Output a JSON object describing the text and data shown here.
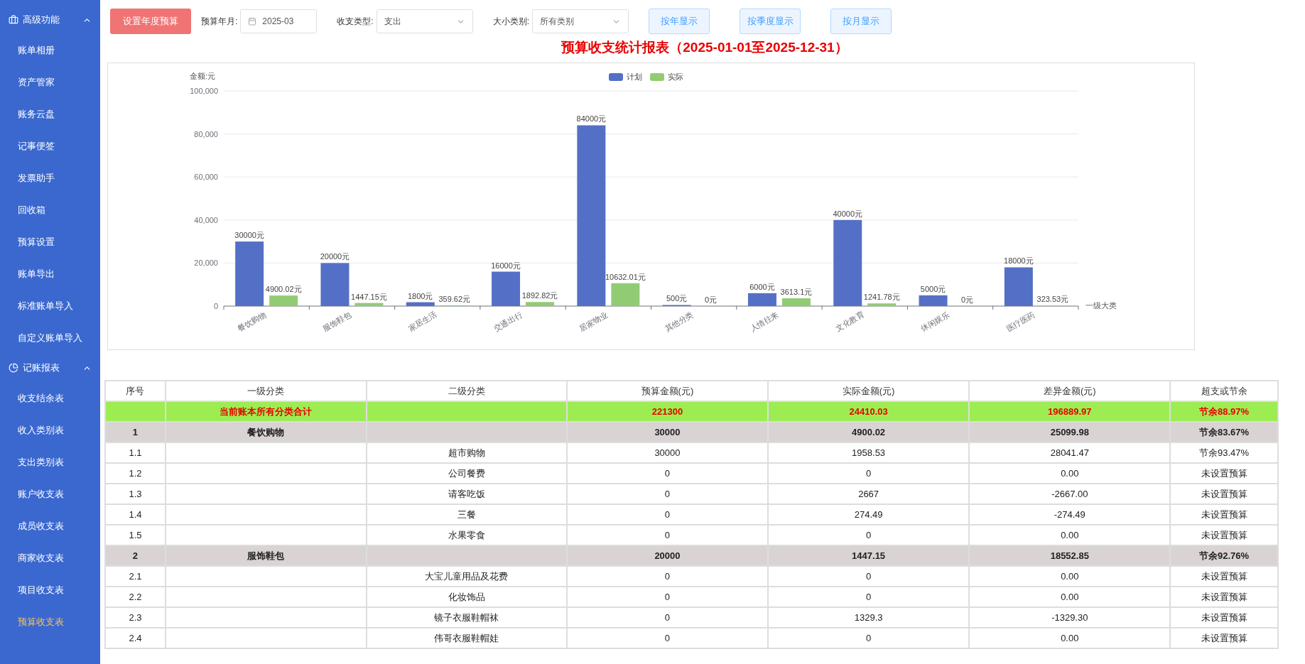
{
  "sidebar": {
    "sections": [
      {
        "title": "高级功能",
        "expanded": true,
        "items": [
          {
            "label": "账单相册",
            "selected": false
          },
          {
            "label": "资产管家",
            "selected": false
          },
          {
            "label": "账务云盘",
            "selected": false
          },
          {
            "label": "记事便签",
            "selected": false
          },
          {
            "label": "发票助手",
            "selected": false
          },
          {
            "label": "回收箱",
            "selected": false
          },
          {
            "label": "预算设置",
            "selected": false
          },
          {
            "label": "账单导出",
            "selected": false
          },
          {
            "label": "标准账单导入",
            "selected": false
          },
          {
            "label": "自定义账单导入",
            "selected": false
          }
        ]
      },
      {
        "title": "记账报表",
        "expanded": true,
        "items": [
          {
            "label": "收支结余表",
            "selected": false
          },
          {
            "label": "收入类别表",
            "selected": false
          },
          {
            "label": "支出类别表",
            "selected": false
          },
          {
            "label": "账户收支表",
            "selected": false
          },
          {
            "label": "成员收支表",
            "selected": false
          },
          {
            "label": "商家收支表",
            "selected": false
          },
          {
            "label": "项目收支表",
            "selected": false
          },
          {
            "label": "预算收支表",
            "selected": true
          }
        ]
      }
    ]
  },
  "toolbar": {
    "primary_button": "设置年度预算",
    "fields": [
      {
        "kind": "date",
        "label": "预算年月:",
        "value": "2025-03"
      },
      {
        "kind": "select",
        "label": "收支类型:",
        "value": "支出"
      },
      {
        "kind": "select",
        "label": "大小类别:",
        "value": "所有类别"
      }
    ],
    "view_buttons": [
      "按年显示",
      "按季度显示",
      "按月显示"
    ]
  },
  "report_title": "预算收支统计报表（2025-01-01至2025-12-31）",
  "chart_data": {
    "type": "bar",
    "ylabel": "金额:元",
    "xlabel": "一级大类",
    "categories": [
      "餐饮购物",
      "服饰鞋包",
      "家居生活",
      "交通出行",
      "居家物业",
      "其他分类",
      "人情往来",
      "文化教育",
      "休闲娱乐",
      "医疗医药"
    ],
    "series": [
      {
        "name": "计划",
        "color": "#5470c6",
        "values": [
          30000,
          20000,
          1800,
          16000,
          84000,
          500,
          6000,
          40000,
          5000,
          18000
        ]
      },
      {
        "name": "实际",
        "color": "#91cc75",
        "values": [
          4900.02,
          1447.15,
          359.62,
          1892.82,
          10632.01,
          0,
          3613.1,
          1241.78,
          0,
          323.53
        ]
      }
    ],
    "grid": true,
    "legend": true,
    "ylim": [
      0,
      100000
    ],
    "yticks": [
      {
        "value": 0,
        "label": "0"
      },
      {
        "value": 20000,
        "label": "20,000"
      },
      {
        "value": 40000,
        "label": "40,000"
      },
      {
        "value": 60000,
        "label": "60,000"
      },
      {
        "value": 80000,
        "label": "80,000"
      },
      {
        "value": 100000,
        "label": "100,000"
      }
    ],
    "value_labels": [
      [
        "30000元",
        "20000元",
        "1800元",
        "16000元",
        "84000元",
        "500元",
        "6000元",
        "40000元",
        "5000元",
        "18000元"
      ],
      [
        "4900.02元",
        "1447.15元",
        "359.62元",
        "1892.82元",
        "10632.01元",
        "0元",
        "3613.1元",
        "1241.78元",
        "0元",
        "323.53元"
      ]
    ]
  },
  "table": {
    "columns": [
      "序号",
      "一级分类",
      "二级分类",
      "预算金额(元)",
      "实际金额(元)",
      "差异金额(元)",
      "超支或节余"
    ],
    "rows": [
      {
        "kind": "total",
        "cells": [
          "",
          "当前账本所有分类合计",
          "",
          "221300",
          "24410.03",
          "196889.97",
          "节余88.97%"
        ]
      },
      {
        "kind": "group",
        "cells": [
          "1",
          "餐饮购物",
          "",
          "30000",
          "4900.02",
          "25099.98",
          "节余83.67%"
        ]
      },
      {
        "kind": "item",
        "cells": [
          "1.1",
          "",
          "超市购物",
          "30000",
          "1958.53",
          "28041.47",
          "节余93.47%"
        ]
      },
      {
        "kind": "item",
        "cells": [
          "1.2",
          "",
          "公司餐费",
          "0",
          "0",
          "0.00",
          "未设置预算"
        ]
      },
      {
        "kind": "item",
        "cells": [
          "1.3",
          "",
          "请客吃饭",
          "0",
          "2667",
          "-2667.00",
          "未设置预算"
        ]
      },
      {
        "kind": "item",
        "cells": [
          "1.4",
          "",
          "三餐",
          "0",
          "274.49",
          "-274.49",
          "未设置预算"
        ]
      },
      {
        "kind": "item",
        "cells": [
          "1.5",
          "",
          "水果零食",
          "0",
          "0",
          "0.00",
          "未设置预算"
        ]
      },
      {
        "kind": "group",
        "cells": [
          "2",
          "服饰鞋包",
          "",
          "20000",
          "1447.15",
          "18552.85",
          "节余92.76%"
        ]
      },
      {
        "kind": "item",
        "cells": [
          "2.1",
          "",
          "大宝儿童用品及花费",
          "0",
          "0",
          "0.00",
          "未设置预算"
        ]
      },
      {
        "kind": "item",
        "cells": [
          "2.2",
          "",
          "化妆饰品",
          "0",
          "0",
          "0.00",
          "未设置预算"
        ]
      },
      {
        "kind": "item",
        "cells": [
          "2.3",
          "",
          "镜子衣服鞋帽袜",
          "0",
          "1329.3",
          "-1329.30",
          "未设置预算"
        ]
      },
      {
        "kind": "item",
        "cells": [
          "2.4",
          "",
          "伟哥衣服鞋帽娃",
          "0",
          "0",
          "0.00",
          "未设置预算"
        ]
      }
    ]
  }
}
